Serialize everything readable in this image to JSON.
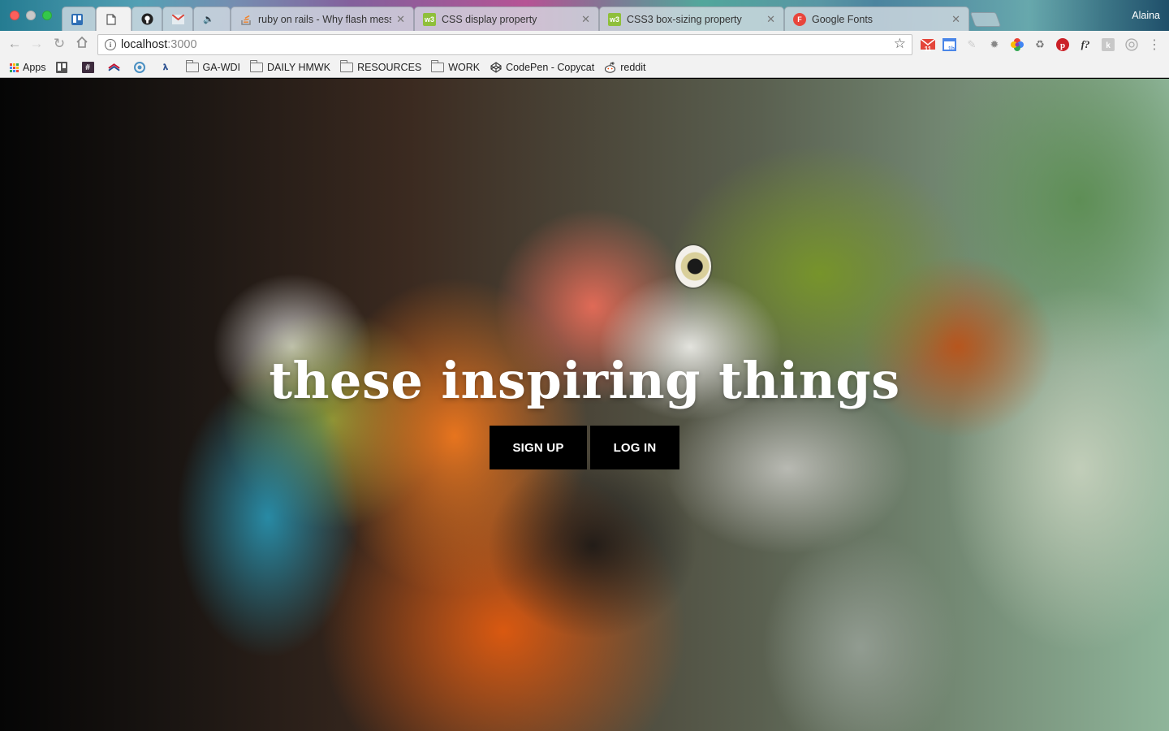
{
  "window": {
    "profile_name": "Alaina"
  },
  "tabs": [
    {
      "label": "",
      "favicon": "trello-icon"
    },
    {
      "label": "",
      "favicon": "document-icon",
      "active": true
    },
    {
      "label": "",
      "favicon": "github-icon"
    },
    {
      "label": "",
      "favicon": "gmail-icon"
    },
    {
      "label": "",
      "favicon": "speaker-icon"
    },
    {
      "label": "ruby on rails - Why flash mess",
      "favicon": "stackoverflow-icon"
    },
    {
      "label": "CSS display property",
      "favicon": "w3-icon"
    },
    {
      "label": "CSS3 box-sizing property",
      "favicon": "w3-icon"
    },
    {
      "label": "Google Fonts",
      "favicon": "google-fonts-icon"
    }
  ],
  "tab_glyphs": {
    "w3": "w3",
    "gf": "F"
  },
  "toolbar": {
    "url_host": "localhost",
    "url_port": ":3000"
  },
  "extensions": {
    "gmail_badge": "11",
    "calendar_badge": "1h"
  },
  "bookmarks": [
    {
      "label": "Apps"
    },
    {
      "label": "GA-WDI"
    },
    {
      "label": "DAILY HMWK"
    },
    {
      "label": "RESOURCES"
    },
    {
      "label": "WORK"
    },
    {
      "label": "CodePen - Copycat"
    },
    {
      "label": "reddit"
    }
  ],
  "hero": {
    "title": "these inspiring things",
    "signup_label": "SIGN UP",
    "login_label": "LOG IN"
  },
  "colors": {
    "button_bg": "#000000",
    "button_text": "#ffffff",
    "title_text": "#ffffff"
  }
}
